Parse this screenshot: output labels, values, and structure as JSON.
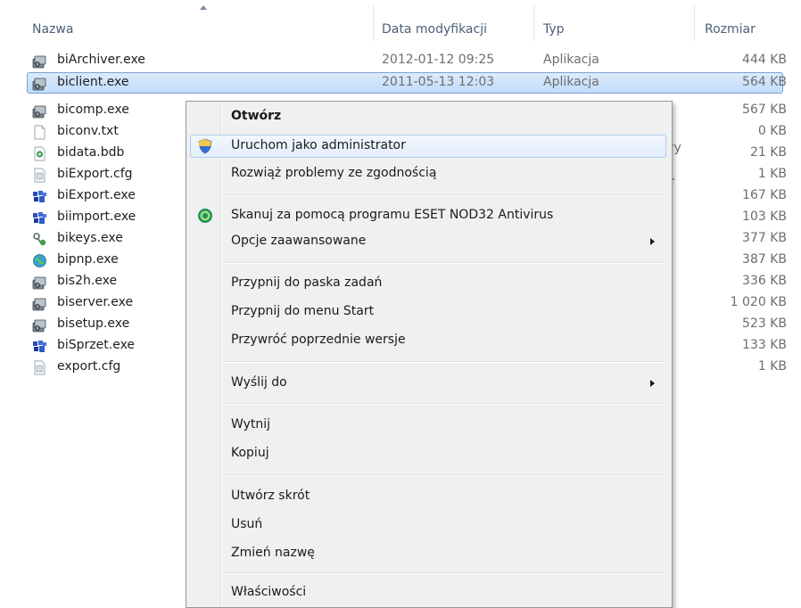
{
  "columns": {
    "name": "Nazwa",
    "date": "Data modyfikacji",
    "type": "Typ",
    "size": "Rozmiar"
  },
  "files": [
    {
      "name": "biArchiver.exe",
      "date": "2012-01-12 09:25",
      "type": "Aplikacja",
      "size": "444 KB",
      "icon": "exe-icon"
    },
    {
      "name": "biclient.exe",
      "date": "2011-05-13 12:03",
      "type": "Aplikacja",
      "size": "564 KB",
      "icon": "exe-icon",
      "selected": true
    },
    {
      "name": "bicomp.exe",
      "date": "",
      "type": "",
      "size": "567 KB",
      "icon": "exe-icon"
    },
    {
      "name": "biconv.txt",
      "date": "",
      "type": "",
      "size": "0 KB",
      "icon": "text-file-icon"
    },
    {
      "name": "bidata.bdb",
      "date": "",
      "type": "",
      "size": "21 KB",
      "icon": "database-file-icon"
    },
    {
      "name": "biExport.cfg",
      "date": "",
      "type": "",
      "size": "1 KB",
      "icon": "config-file-icon"
    },
    {
      "name": "biExport.exe",
      "date": "",
      "type": "",
      "size": "167 KB",
      "icon": "blue-app-icon"
    },
    {
      "name": "biimport.exe",
      "date": "",
      "type": "",
      "size": "103 KB",
      "icon": "blue-app-icon"
    },
    {
      "name": "bikeys.exe",
      "date": "",
      "type": "",
      "size": "377 KB",
      "icon": "keys-app-icon"
    },
    {
      "name": "bipnp.exe",
      "date": "",
      "type": "",
      "size": "387 KB",
      "icon": "globe-app-icon"
    },
    {
      "name": "bis2h.exe",
      "date": "",
      "type": "",
      "size": "336 KB",
      "icon": "exe-icon"
    },
    {
      "name": "biserver.exe",
      "date": "",
      "type": "",
      "size": "1 020 KB",
      "icon": "exe-icon"
    },
    {
      "name": "bisetup.exe",
      "date": "",
      "type": "",
      "size": "523 KB",
      "icon": "exe-icon"
    },
    {
      "name": "biSprzet.exe",
      "date": "",
      "type": "",
      "size": "133 KB",
      "icon": "blue-app-icon"
    },
    {
      "name": "export.cfg",
      "date": "",
      "type": "",
      "size": "1 KB",
      "icon": "config-file-icon"
    }
  ],
  "peeks": {
    "row3_type": "wy",
    "row4_type": "..."
  },
  "context_menu": {
    "open": "Otwórz",
    "run_as_admin": "Uruchom jako administrator",
    "troubleshoot": "Rozwiąż problemy ze zgodnością",
    "scan_eset": "Skanuj za pomocą programu ESET NOD32 Antivirus",
    "advanced": "Opcje zaawansowane",
    "pin_taskbar": "Przypnij do paska zadań",
    "pin_start": "Przypnij do menu Start",
    "restore": "Przywróć poprzednie wersje",
    "send_to": "Wyślij do",
    "cut": "Wytnij",
    "copy": "Kopiuj",
    "shortcut": "Utwórz skrót",
    "delete": "Usuń",
    "rename": "Zmień nazwę",
    "properties": "Właściwości"
  },
  "colors": {
    "selection": "#cce4fc",
    "header_text": "#4c607a",
    "menu_bg": "#f0f0f0"
  }
}
